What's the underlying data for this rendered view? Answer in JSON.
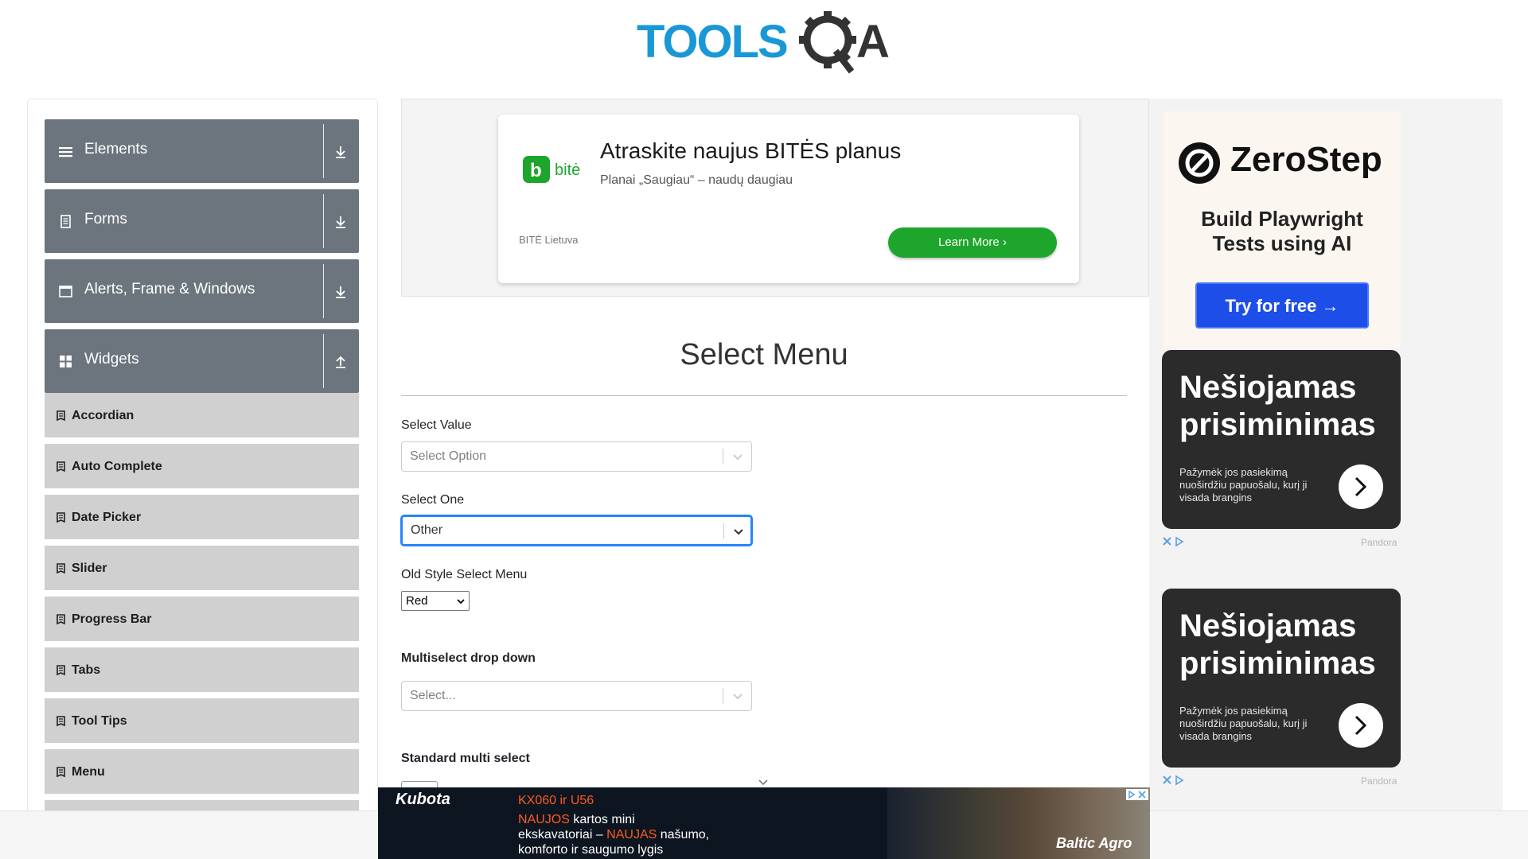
{
  "header": {
    "logo_text_tools": "TOOLS",
    "logo_text_qa": "QA"
  },
  "sidebar": {
    "groups": [
      {
        "label": "Elements",
        "icon": "hamburger-icon",
        "expanded": false
      },
      {
        "label": "Forms",
        "icon": "document-icon",
        "expanded": false
      },
      {
        "label": "Alerts, Frame & Windows",
        "icon": "window-icon",
        "expanded": false
      },
      {
        "label": "Widgets",
        "icon": "grid-icon",
        "expanded": true
      }
    ],
    "items": [
      {
        "label": "Accordian"
      },
      {
        "label": "Auto Complete"
      },
      {
        "label": "Date Picker"
      },
      {
        "label": "Slider"
      },
      {
        "label": "Progress Bar"
      },
      {
        "label": "Tabs"
      },
      {
        "label": "Tool Tips"
      },
      {
        "label": "Menu"
      }
    ]
  },
  "top_ad": {
    "title": "Atraskite naujus BITĖS planus",
    "subtitle": "Planai „Saugiau“ – naudų daugiau",
    "brand": "BITĖ Lietuva",
    "button": "Learn More",
    "logo_text": "bitė",
    "accent": "#1ea52c"
  },
  "main": {
    "title": "Select Menu",
    "select_value": {
      "label": "Select Value",
      "placeholder": "Select Option"
    },
    "select_one": {
      "label": "Select One",
      "value": "Other"
    },
    "old_style": {
      "label": "Old Style Select Menu",
      "value": "Red"
    },
    "multiselect": {
      "label": "Multiselect drop down",
      "placeholder": "Select..."
    },
    "standard_multi": {
      "label": "Standard multi select"
    }
  },
  "right_ads": {
    "zerostep": {
      "name": "ZeroStep",
      "tagline_1": "Build Playwright",
      "tagline_2": "Tests using AI",
      "button": "Try for free →"
    },
    "pandora": [
      {
        "head_1": "Nešiojamas",
        "head_2": "prisiminimas",
        "body": "Pažymėk jos pasiekimą nuoširdžiu papuošalu, kurį ji visada brangins",
        "brand": "Pandora"
      },
      {
        "head_1": "Nešiojamas",
        "head_2": "prisiminimas",
        "body": "Pažymėk jos pasiekimą nuoširdžiu papuošalu, kurį ji visada brangins",
        "brand": "Pandora"
      }
    ]
  },
  "bottom_ad": {
    "brand": "Kubota",
    "model": "KX060 ir U56",
    "line1_hl": "NAUJOS",
    "line1": " kartos mini",
    "line2a": "ekskavatoriai – ",
    "line2_hl": "NAUJAS",
    "line2b": " našumo,",
    "line3": "komforto ir saugumo lygis",
    "dealer": "Baltic Agro",
    "accent": "#ff5a1f"
  }
}
